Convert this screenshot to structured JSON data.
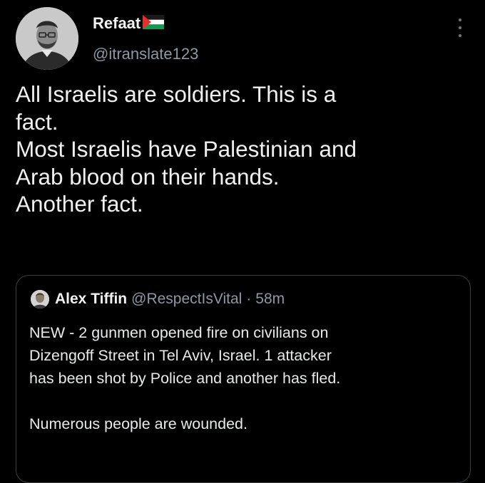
{
  "author": {
    "name": "Refaat",
    "flag_icon": "palestine-flag-icon",
    "handle": "@itranslate123"
  },
  "tweet": {
    "text": "All Israelis are soldiers. This is a\nfact.\nMost Israelis have Palestinian and\nArab blood on their hands.\nAnother fact."
  },
  "quoted_tweet": {
    "author_name": "Alex Tiffin",
    "handle": "@RespectIsVital",
    "separator": "·",
    "time": "58m",
    "text": "NEW - 2 gunmen opened fire on civilians on\nDizengoff Street in Tel Aviv, Israel. 1 attacker\nhas been shot by Police and another has fled.\n\nNumerous people are wounded."
  },
  "colors": {
    "background": "#000000",
    "text": "#e7e9ea",
    "secondary": "#8b98a5",
    "border": "#3a3f44"
  }
}
